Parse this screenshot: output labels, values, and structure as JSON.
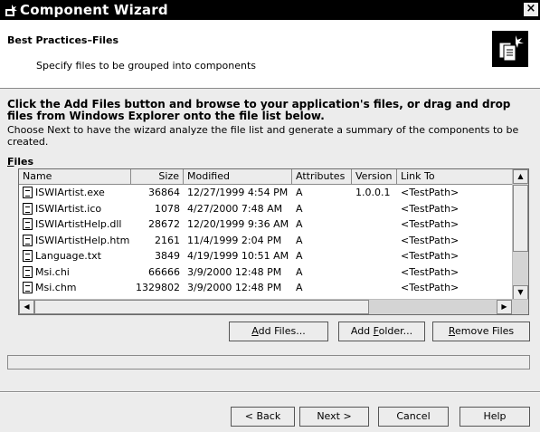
{
  "window": {
    "title": "Component Wizard",
    "close_glyph": "×"
  },
  "header": {
    "title": "Best Practices–Files",
    "subtitle": "Specify files to be grouped into components",
    "icon": "wizard-files-icon"
  },
  "instructions": {
    "bold": "Click the Add Files button and browse to your application's files, or drag and drop files from Windows Explorer onto the file list below.",
    "normal": "Choose Next to have the wizard analyze the file list and generate a summary of the components to be created."
  },
  "files_label": "Files",
  "list": {
    "columns": [
      "Name",
      "Size",
      "Modified",
      "Attributes",
      "Version",
      "Link To"
    ],
    "rows": [
      [
        "ISWIArtist.exe",
        "36864",
        "12/27/1999 4:54 PM",
        "A",
        "1.0.0.1",
        "<TestPath>"
      ],
      [
        "ISWIArtist.ico",
        "1078",
        "4/27/2000 7:48 AM",
        "A",
        "",
        "<TestPath>"
      ],
      [
        "ISWIArtistHelp.dll",
        "28672",
        "12/20/1999 9:36 AM",
        "A",
        "",
        "<TestPath>"
      ],
      [
        "ISWIArtistHelp.htm",
        "2161",
        "11/4/1999 2:04 PM",
        "A",
        "",
        "<TestPath>"
      ],
      [
        "Language.txt",
        "3849",
        "4/19/1999 10:51 AM",
        "A",
        "",
        "<TestPath>"
      ],
      [
        "Msi.chi",
        "66666",
        "3/9/2000 12:48 PM",
        "A",
        "",
        "<TestPath>"
      ],
      [
        "Msi.chm",
        "1329802",
        "3/9/2000 12:48 PM",
        "A",
        "",
        "<TestPath>"
      ]
    ]
  },
  "buttons": {
    "add_files": "Add Files...",
    "add_folder": "Add Folder...",
    "remove_files": "Remove Files",
    "back": "< Back",
    "next": "Next >",
    "cancel": "Cancel",
    "help": "Help"
  },
  "progress": 0
}
